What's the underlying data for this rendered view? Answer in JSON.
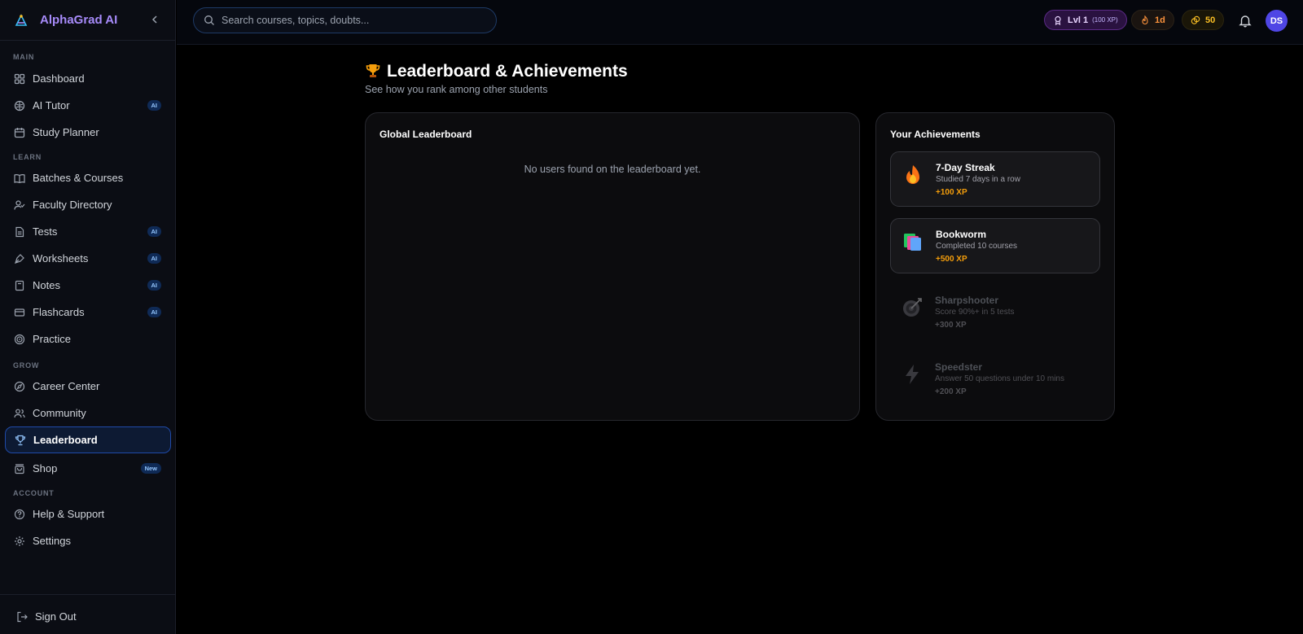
{
  "brand": {
    "name": "AlphaGrad AI"
  },
  "sidebar": {
    "sections": {
      "main": "MAIN",
      "learn": "LEARN",
      "grow": "GROW",
      "account": "ACCOUNT"
    },
    "items": [
      {
        "label": "Dashboard",
        "icon": "grid-icon"
      },
      {
        "label": "AI Tutor",
        "icon": "brain-icon",
        "badge": "AI"
      },
      {
        "label": "Study Planner",
        "icon": "calendar-icon"
      },
      {
        "label": "Batches & Courses",
        "icon": "book-open-icon"
      },
      {
        "label": "Faculty Directory",
        "icon": "user-check-icon"
      },
      {
        "label": "Tests",
        "icon": "file-text-icon",
        "badge": "AI"
      },
      {
        "label": "Worksheets",
        "icon": "pen-tool-icon",
        "badge": "AI"
      },
      {
        "label": "Notes",
        "icon": "notebook-icon",
        "badge": "AI"
      },
      {
        "label": "Flashcards",
        "icon": "cards-icon",
        "badge": "AI"
      },
      {
        "label": "Practice",
        "icon": "target-icon"
      },
      {
        "label": "Career Center",
        "icon": "compass-icon"
      },
      {
        "label": "Community",
        "icon": "users-icon"
      },
      {
        "label": "Leaderboard",
        "icon": "trophy-icon",
        "active": true
      },
      {
        "label": "Shop",
        "icon": "bag-icon",
        "badge": "New"
      },
      {
        "label": "Help & Support",
        "icon": "help-circle-icon"
      },
      {
        "label": "Settings",
        "icon": "gear-icon"
      }
    ],
    "sign_out": "Sign Out"
  },
  "topbar": {
    "search_placeholder": "Search courses, topics, doubts...",
    "level_label": "Lvl 1",
    "level_xp": "(100 XP)",
    "streak": "1d",
    "coins": "50",
    "avatar_initials": "DS"
  },
  "page": {
    "title": "Leaderboard & Achievements",
    "subtitle": "See how you rank among other students"
  },
  "leaderboard": {
    "title": "Global Leaderboard",
    "empty_message": "No users found on the leaderboard yet."
  },
  "achievements": {
    "title": "Your Achievements",
    "items": [
      {
        "name": "7-Day Streak",
        "description": "Studied 7 days in a row",
        "xp": "+100 XP",
        "icon": "fire-icon",
        "unlocked": true
      },
      {
        "name": "Bookworm",
        "description": "Completed 10 courses",
        "xp": "+500 XP",
        "icon": "books-icon",
        "unlocked": true
      },
      {
        "name": "Sharpshooter",
        "description": "Score 90%+ in 5 tests",
        "xp": "+300 XP",
        "icon": "dart-target-icon",
        "unlocked": false
      },
      {
        "name": "Speedster",
        "description": "Answer 50 questions under 10 mins",
        "xp": "+200 XP",
        "icon": "lightning-icon",
        "unlocked": false
      }
    ]
  },
  "colors": {
    "brand_accent": "#a78bfa",
    "active_nav_border": "#1f4aa8",
    "xp_gold": "#f59e0b",
    "avatar_bg": "#4f46e5"
  }
}
